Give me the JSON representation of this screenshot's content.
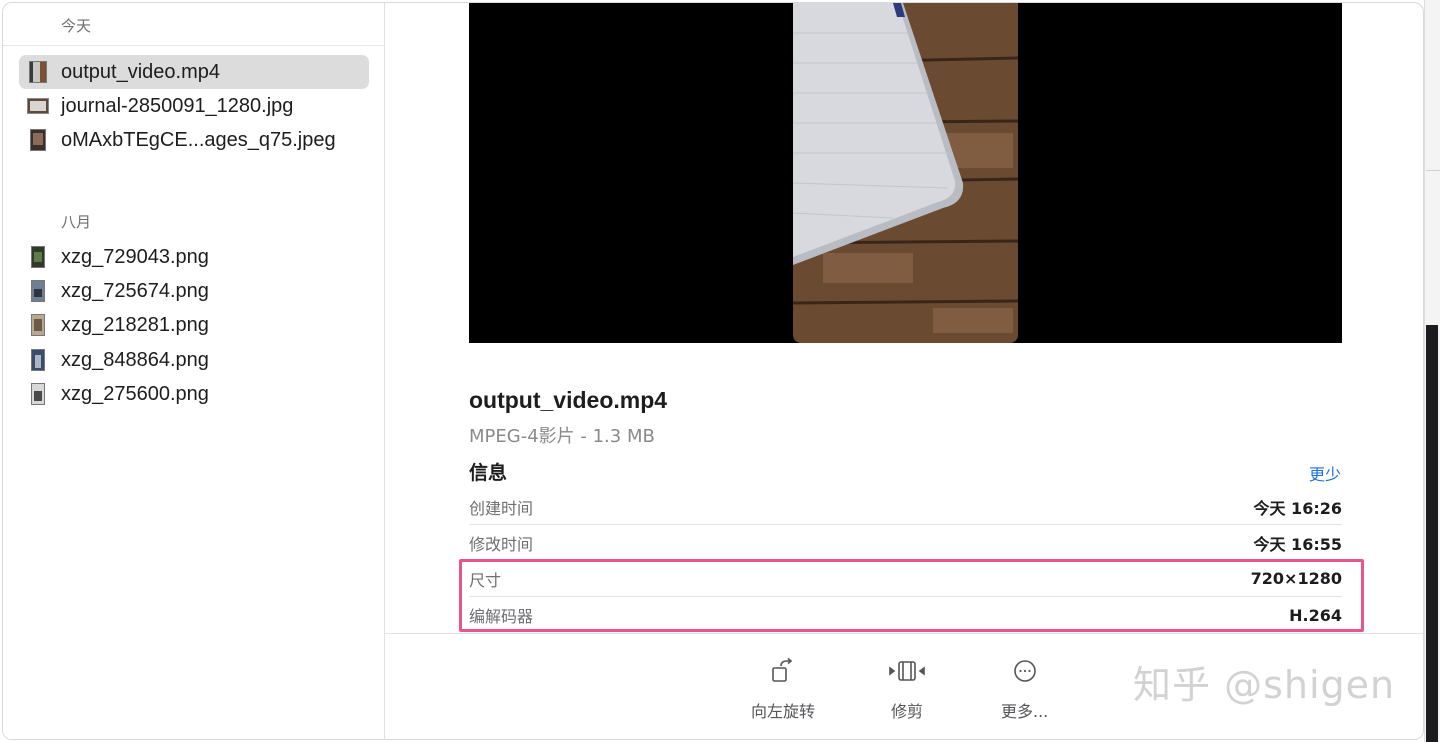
{
  "sidebar": {
    "sections": [
      {
        "title": "今天",
        "files": [
          {
            "name": "output_video.mp4",
            "selected": true
          },
          {
            "name": "journal-2850091_1280.jpg",
            "selected": false
          },
          {
            "name": "oMAxbTEgCE...ages_q75.jpeg",
            "selected": false
          }
        ]
      },
      {
        "title": "八月",
        "files": [
          {
            "name": "xzg_729043.png",
            "selected": false
          },
          {
            "name": "xzg_725674.png",
            "selected": false
          },
          {
            "name": "xzg_218281.png",
            "selected": false
          },
          {
            "name": "xzg_848864.png",
            "selected": false
          },
          {
            "name": "xzg_275600.png",
            "selected": false
          }
        ]
      }
    ]
  },
  "preview": {
    "file_name": "output_video.mp4",
    "file_kind": "MPEG-4影片 - 1.3 MB",
    "info_title": "信息",
    "less_link": "更少",
    "info_rows": [
      {
        "key": "创建时间",
        "value": "今天 16:26"
      },
      {
        "key": "修改时间",
        "value": "今天 16:55"
      },
      {
        "key": "尺寸",
        "value": "720×1280"
      },
      {
        "key": "编解码器",
        "value": "H.264"
      }
    ],
    "highlight_color": "#e8558c"
  },
  "toolbar": {
    "rotate_label": "向左旋转",
    "trim_label": "修剪",
    "more_label": "更多..."
  },
  "watermark": "知乎 @shigen",
  "colors": {
    "accent_link": "#1a6fd8",
    "selected_row": "#dcdcdc"
  }
}
